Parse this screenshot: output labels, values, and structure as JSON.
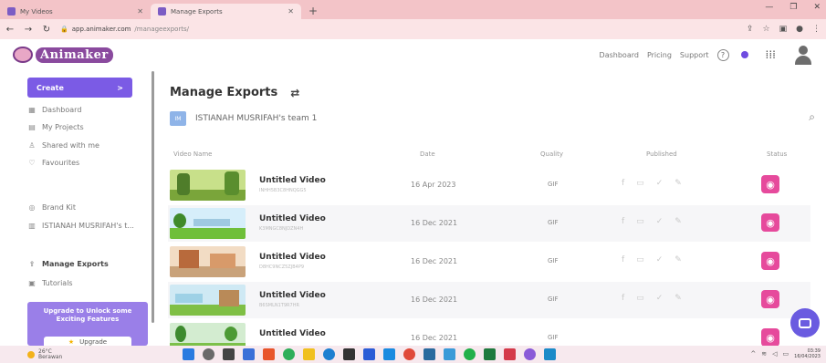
{
  "browser": {
    "tabs": [
      {
        "title": "My Videos",
        "active": false
      },
      {
        "title": "Manage Exports",
        "active": true
      }
    ],
    "address": {
      "domain": "app.animaker.com",
      "path": "/manageexports/"
    }
  },
  "header": {
    "logo_text": "Animaker",
    "nav": [
      "Dashboard",
      "Pricing",
      "Support"
    ],
    "help_glyph": "?",
    "apps_glyph": "⋮⋮⋮"
  },
  "sidebar": {
    "create_label": "Create",
    "create_chevron": ">",
    "items": [
      {
        "label": "Dashboard",
        "icon": "dashboard-icon",
        "glyph": "▦",
        "active": false
      },
      {
        "label": "My Projects",
        "icon": "projects-icon",
        "glyph": "▤",
        "active": false
      },
      {
        "label": "Shared with me",
        "icon": "shared-icon",
        "glyph": "♙",
        "active": false
      },
      {
        "label": "Favourites",
        "icon": "heart-icon",
        "glyph": "♡",
        "active": false
      },
      {
        "label": "Brand Kit",
        "icon": "brand-kit-icon",
        "glyph": "◎",
        "active": false
      },
      {
        "label": "ISTIANAH MUSRIFAH's t...",
        "icon": "team-icon",
        "glyph": "▥",
        "active": false
      },
      {
        "label": "Manage Exports",
        "icon": "exports-icon",
        "glyph": "⇪",
        "active": true
      },
      {
        "label": "Tutorials",
        "icon": "tutorials-icon",
        "glyph": "▣",
        "active": false
      }
    ],
    "upgrade": {
      "line1": "Upgrade to Unlock some",
      "line2": "Exciting Features",
      "button": "Upgrade"
    }
  },
  "main": {
    "title": "Manage Exports",
    "refresh_glyph": "⇄",
    "team": {
      "badge": "IM",
      "name": "ISTIANAH MUSRIFAH's team 1"
    },
    "search_glyph": "⌕",
    "columns": [
      "Video Name",
      "Date",
      "Quality",
      "Published",
      "Status"
    ],
    "rows": [
      {
        "title": "Untitled Video",
        "id": "INHH5B3C8HNQGG5",
        "date": "16 Apr 2023",
        "quality": "GIF"
      },
      {
        "title": "Untitled Video",
        "id": "K3MNGC8NJDZN4H",
        "date": "16 Dec 2021",
        "quality": "GIF"
      },
      {
        "title": "Untitled Video",
        "id": "D8HC9NCZ5ZJB4P9",
        "date": "16 Dec 2021",
        "quality": "GIF"
      },
      {
        "title": "Untitled Video",
        "id": "B6SMLN1T9R7HR",
        "date": "16 Dec 2021",
        "quality": "GIF"
      },
      {
        "title": "Untitled Video",
        "id": "",
        "date": "16 Dec 2021",
        "quality": "GIF"
      }
    ],
    "publish_glyphs": [
      "f",
      "▭",
      "✓",
      "✎"
    ],
    "status_glyph": "◉"
  },
  "taskbar": {
    "weather": {
      "temp": "26°C",
      "condition": "Berawan"
    },
    "clock": {
      "time": "03:39",
      "date": "16/04/2023"
    }
  },
  "colors": {
    "accent": "#7b5be5",
    "status": "#e64a9c",
    "chrome": "#f3c4c8"
  }
}
